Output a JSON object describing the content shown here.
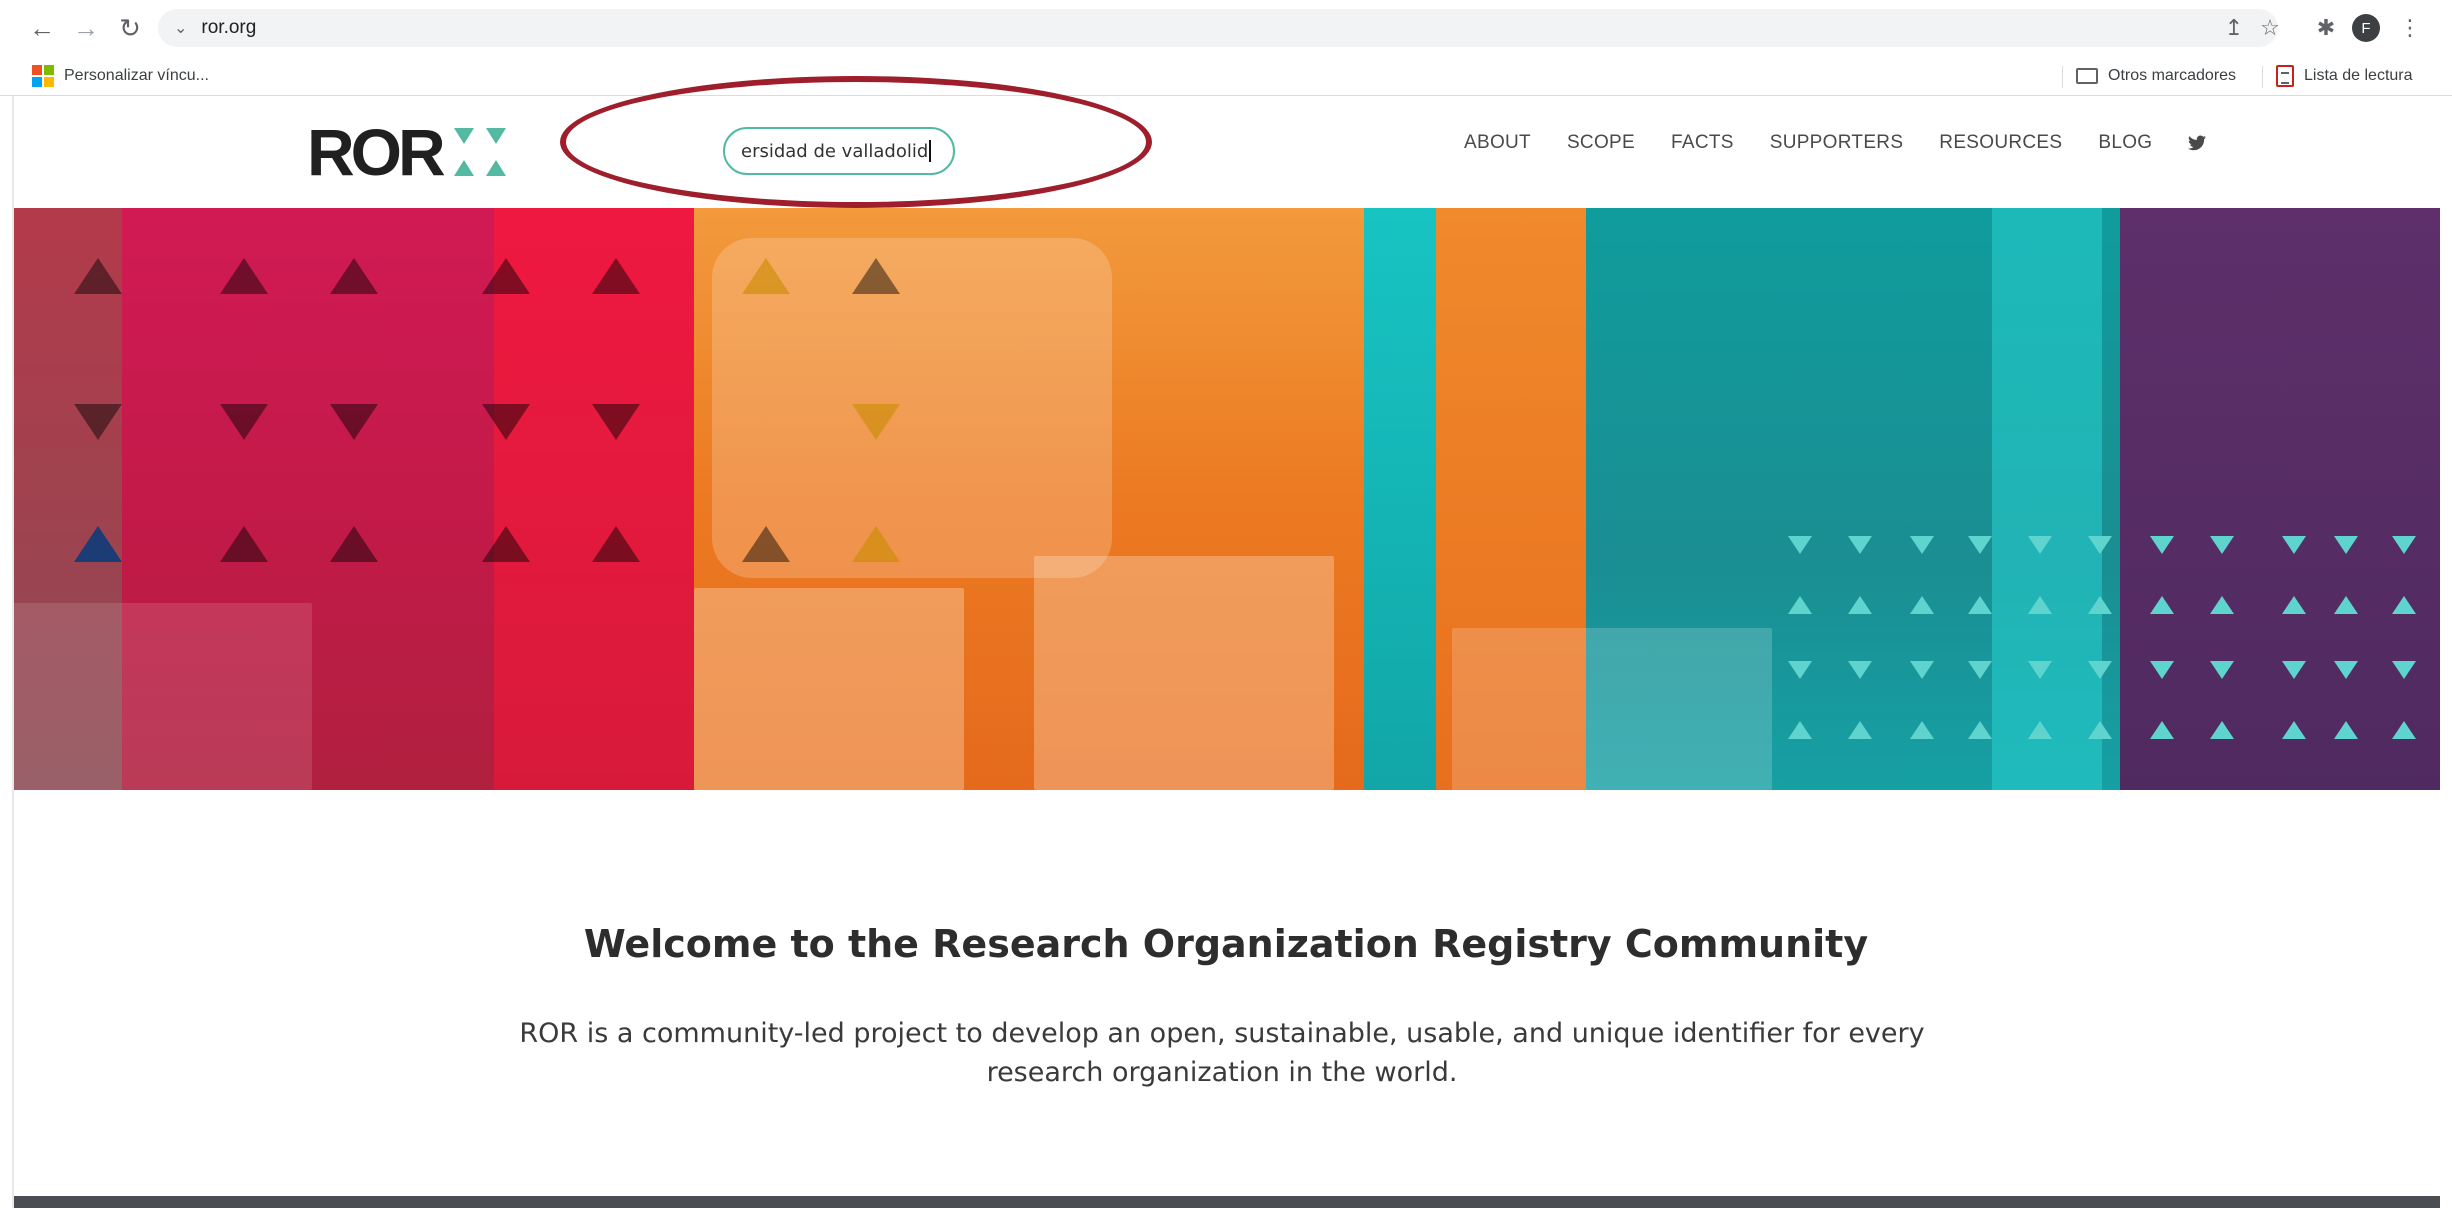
{
  "browser": {
    "url": "ror.org",
    "icons": {
      "back": "arrow-left-icon",
      "forward": "arrow-right-icon",
      "reload": "reload-icon",
      "site_info": "chevron-down-icon",
      "share": "share-icon",
      "bookmark": "star-icon",
      "extensions": "puzzle-icon",
      "menu": "kebab-menu-icon"
    },
    "profile_initial": "F",
    "bookmarks_bar": {
      "left_item": "Personalizar víncu...",
      "other_bookmarks": "Otros marcadores",
      "reading_list": "Lista de lectura"
    }
  },
  "site": {
    "logo_text": "ROR",
    "search": {
      "value": "ersidad de valladolid"
    },
    "nav": [
      "ABOUT",
      "SCOPE",
      "FACTS",
      "SUPPORTERS",
      "RESOURCES",
      "BLOG"
    ],
    "twitter_icon": "twitter-icon",
    "brand_color": "#53baa1"
  },
  "hero": {
    "bands": [
      "#c91b4a",
      "#e8173f",
      "#ef7a1f",
      "#15b8b6",
      "#109aa0",
      "#5a2d66"
    ]
  },
  "welcome": {
    "title": "Welcome to the Research Organization Registry Community",
    "body": "ROR is a community-led project to develop an open, sustainable, usable, and unique identifier for every research organization in the world."
  },
  "annotation": {
    "color": "#9e1e2c"
  }
}
